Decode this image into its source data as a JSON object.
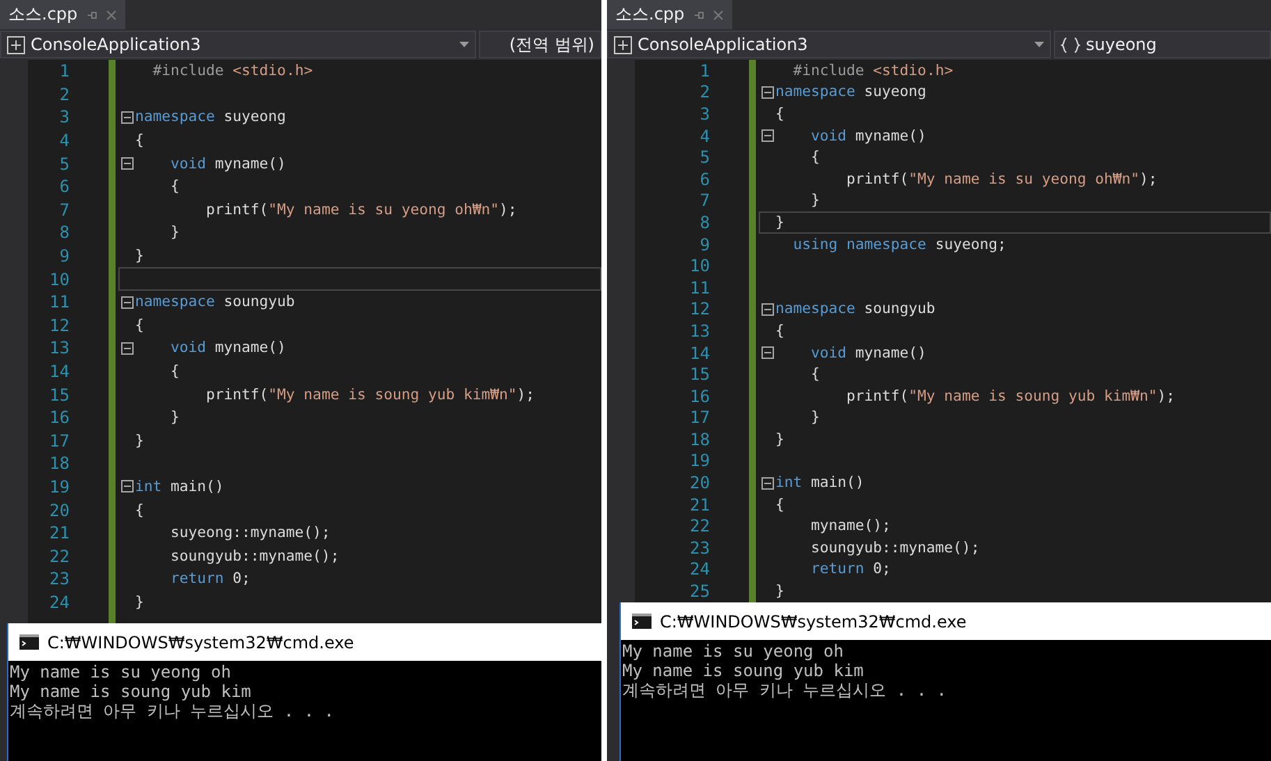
{
  "panes": [
    {
      "tab": {
        "title": "소스.cpp",
        "selected": true
      },
      "project": "ConsoleApplication3",
      "scope": {
        "kind": "global",
        "label": "(전역 범위)"
      },
      "lines": [
        {
          "number": "1",
          "fold": false,
          "current": false,
          "tokens": [
            {
              "text": "  #include ",
              "kind": "pre"
            },
            {
              "text": "<stdio.h>",
              "kind": "str"
            }
          ]
        },
        {
          "number": "2",
          "fold": false,
          "current": false
        },
        {
          "number": "3",
          "fold": true,
          "current": false,
          "tokens": [
            {
              "text": "namespace",
              "kind": "kw"
            },
            {
              "text": " suyeong",
              "kind": "plain"
            }
          ]
        },
        {
          "number": "4",
          "fold": false,
          "current": false,
          "tokens": [
            {
              "text": "{",
              "kind": "plain"
            }
          ]
        },
        {
          "number": "5",
          "fold": true,
          "current": false,
          "tokens": [
            {
              "text": "    void",
              "kind": "kw"
            },
            {
              "text": " myname()",
              "kind": "plain"
            }
          ]
        },
        {
          "number": "6",
          "fold": false,
          "current": false,
          "tokens": [
            {
              "text": "    {",
              "kind": "plain"
            }
          ]
        },
        {
          "number": "7",
          "fold": false,
          "current": false,
          "tokens": [
            {
              "text": "        printf(",
              "kind": "plain"
            },
            {
              "text": "\"My name is su yeong oh₩n\"",
              "kind": "str"
            },
            {
              "text": ");",
              "kind": "plain"
            }
          ]
        },
        {
          "number": "8",
          "fold": false,
          "current": false,
          "tokens": [
            {
              "text": "    }",
              "kind": "plain"
            }
          ]
        },
        {
          "number": "9",
          "fold": false,
          "current": false,
          "tokens": [
            {
              "text": "}",
              "kind": "plain"
            }
          ]
        },
        {
          "number": "10",
          "fold": false,
          "current": true
        },
        {
          "number": "11",
          "fold": true,
          "current": false,
          "tokens": [
            {
              "text": "namespace",
              "kind": "kw"
            },
            {
              "text": " soungyub",
              "kind": "plain"
            }
          ]
        },
        {
          "number": "12",
          "fold": false,
          "current": false,
          "tokens": [
            {
              "text": "{",
              "kind": "plain"
            }
          ]
        },
        {
          "number": "13",
          "fold": true,
          "current": false,
          "tokens": [
            {
              "text": "    void",
              "kind": "kw"
            },
            {
              "text": " myname()",
              "kind": "plain"
            }
          ]
        },
        {
          "number": "14",
          "fold": false,
          "current": false,
          "tokens": [
            {
              "text": "    {",
              "kind": "plain"
            }
          ]
        },
        {
          "number": "15",
          "fold": false,
          "current": false,
          "tokens": [
            {
              "text": "        printf(",
              "kind": "plain"
            },
            {
              "text": "\"My name is soung yub kim₩n\"",
              "kind": "str"
            },
            {
              "text": ");",
              "kind": "plain"
            }
          ]
        },
        {
          "number": "16",
          "fold": false,
          "current": false,
          "tokens": [
            {
              "text": "    }",
              "kind": "plain"
            }
          ]
        },
        {
          "number": "17",
          "fold": false,
          "current": false,
          "tokens": [
            {
              "text": "}",
              "kind": "plain"
            }
          ]
        },
        {
          "number": "18",
          "fold": false,
          "current": false
        },
        {
          "number": "19",
          "fold": true,
          "current": false,
          "tokens": [
            {
              "text": "int",
              "kind": "kw"
            },
            {
              "text": " main()",
              "kind": "plain"
            }
          ]
        },
        {
          "number": "20",
          "fold": false,
          "current": false,
          "tokens": [
            {
              "text": "{",
              "kind": "plain"
            }
          ]
        },
        {
          "number": "21",
          "fold": false,
          "current": false,
          "tokens": [
            {
              "text": "    suyeong::myname();",
              "kind": "plain"
            }
          ]
        },
        {
          "number": "22",
          "fold": false,
          "current": false,
          "tokens": [
            {
              "text": "    soungyub::myname();",
              "kind": "plain"
            }
          ]
        },
        {
          "number": "23",
          "fold": false,
          "current": false,
          "tokens": [
            {
              "text": "    return",
              "kind": "kw"
            },
            {
              "text": " 0;",
              "kind": "plain"
            }
          ]
        },
        {
          "number": "24",
          "fold": false,
          "current": false,
          "tokens": [
            {
              "text": "}",
              "kind": "plain"
            }
          ]
        }
      ],
      "console": {
        "title": "C:₩WINDOWS₩system32₩cmd.exe",
        "output": [
          "My name is su yeong oh",
          "My name is soung yub kim",
          "계속하려면 아무 키나 누르십시오 . . ."
        ]
      }
    },
    {
      "tab": {
        "title": "소스.cpp",
        "selected": true
      },
      "project": "ConsoleApplication3",
      "scope": {
        "kind": "namespace",
        "label": "suyeong"
      },
      "lines": [
        {
          "number": "1",
          "fold": false,
          "current": false,
          "tokens": [
            {
              "text": "  #include ",
              "kind": "pre"
            },
            {
              "text": "<stdio.h>",
              "kind": "str"
            }
          ]
        },
        {
          "number": "2",
          "fold": true,
          "current": false,
          "tokens": [
            {
              "text": "namespace",
              "kind": "kw"
            },
            {
              "text": " suyeong",
              "kind": "plain"
            }
          ]
        },
        {
          "number": "3",
          "fold": false,
          "current": false,
          "tokens": [
            {
              "text": "{",
              "kind": "plain"
            }
          ]
        },
        {
          "number": "4",
          "fold": true,
          "current": false,
          "tokens": [
            {
              "text": "    void",
              "kind": "kw"
            },
            {
              "text": " myname()",
              "kind": "plain"
            }
          ]
        },
        {
          "number": "5",
          "fold": false,
          "current": false,
          "tokens": [
            {
              "text": "    {",
              "kind": "plain"
            }
          ]
        },
        {
          "number": "6",
          "fold": false,
          "current": false,
          "tokens": [
            {
              "text": "        printf(",
              "kind": "plain"
            },
            {
              "text": "\"My name is su yeong oh₩n\"",
              "kind": "str"
            },
            {
              "text": ");",
              "kind": "plain"
            }
          ]
        },
        {
          "number": "7",
          "fold": false,
          "current": false,
          "tokens": [
            {
              "text": "    }",
              "kind": "plain"
            }
          ]
        },
        {
          "number": "8",
          "fold": false,
          "current": true,
          "tokens": [
            {
              "text": "}",
              "kind": "plain"
            }
          ]
        },
        {
          "number": "9",
          "fold": false,
          "current": false,
          "tokens": [
            {
              "text": "  using namespace",
              "kind": "kw"
            },
            {
              "text": " suyeong;",
              "kind": "plain"
            }
          ]
        },
        {
          "number": "10",
          "fold": false,
          "current": false
        },
        {
          "number": "11",
          "fold": false,
          "current": false
        },
        {
          "number": "12",
          "fold": true,
          "current": false,
          "tokens": [
            {
              "text": "namespace",
              "kind": "kw"
            },
            {
              "text": " soungyub",
              "kind": "plain"
            }
          ]
        },
        {
          "number": "13",
          "fold": false,
          "current": false,
          "tokens": [
            {
              "text": "{",
              "kind": "plain"
            }
          ]
        },
        {
          "number": "14",
          "fold": true,
          "current": false,
          "tokens": [
            {
              "text": "    void",
              "kind": "kw"
            },
            {
              "text": " myname()",
              "kind": "plain"
            }
          ]
        },
        {
          "number": "15",
          "fold": false,
          "current": false,
          "tokens": [
            {
              "text": "    {",
              "kind": "plain"
            }
          ]
        },
        {
          "number": "16",
          "fold": false,
          "current": false,
          "tokens": [
            {
              "text": "        printf(",
              "kind": "plain"
            },
            {
              "text": "\"My name is soung yub kim₩n\"",
              "kind": "str"
            },
            {
              "text": ");",
              "kind": "plain"
            }
          ]
        },
        {
          "number": "17",
          "fold": false,
          "current": false,
          "tokens": [
            {
              "text": "    }",
              "kind": "plain"
            }
          ]
        },
        {
          "number": "18",
          "fold": false,
          "current": false,
          "tokens": [
            {
              "text": "}",
              "kind": "plain"
            }
          ]
        },
        {
          "number": "19",
          "fold": false,
          "current": false
        },
        {
          "number": "20",
          "fold": true,
          "current": false,
          "tokens": [
            {
              "text": "int",
              "kind": "kw"
            },
            {
              "text": " main()",
              "kind": "plain"
            }
          ]
        },
        {
          "number": "21",
          "fold": false,
          "current": false,
          "tokens": [
            {
              "text": "{",
              "kind": "plain"
            }
          ]
        },
        {
          "number": "22",
          "fold": false,
          "current": false,
          "tokens": [
            {
              "text": "    myname();",
              "kind": "plain"
            }
          ]
        },
        {
          "number": "23",
          "fold": false,
          "current": false,
          "tokens": [
            {
              "text": "    soungyub::myname();",
              "kind": "plain"
            }
          ]
        },
        {
          "number": "24",
          "fold": false,
          "current": false,
          "tokens": [
            {
              "text": "    return",
              "kind": "kw"
            },
            {
              "text": " 0;",
              "kind": "plain"
            }
          ]
        },
        {
          "number": "25",
          "fold": false,
          "current": false,
          "tokens": [
            {
              "text": "}",
              "kind": "plain"
            }
          ]
        }
      ],
      "console": {
        "title": "C:₩WINDOWS₩system32₩cmd.exe",
        "output": [
          "My name is su yeong oh",
          "My name is soung yub kim",
          "계속하려면 아무 키나 누르십시오 . . ."
        ]
      }
    }
  ]
}
